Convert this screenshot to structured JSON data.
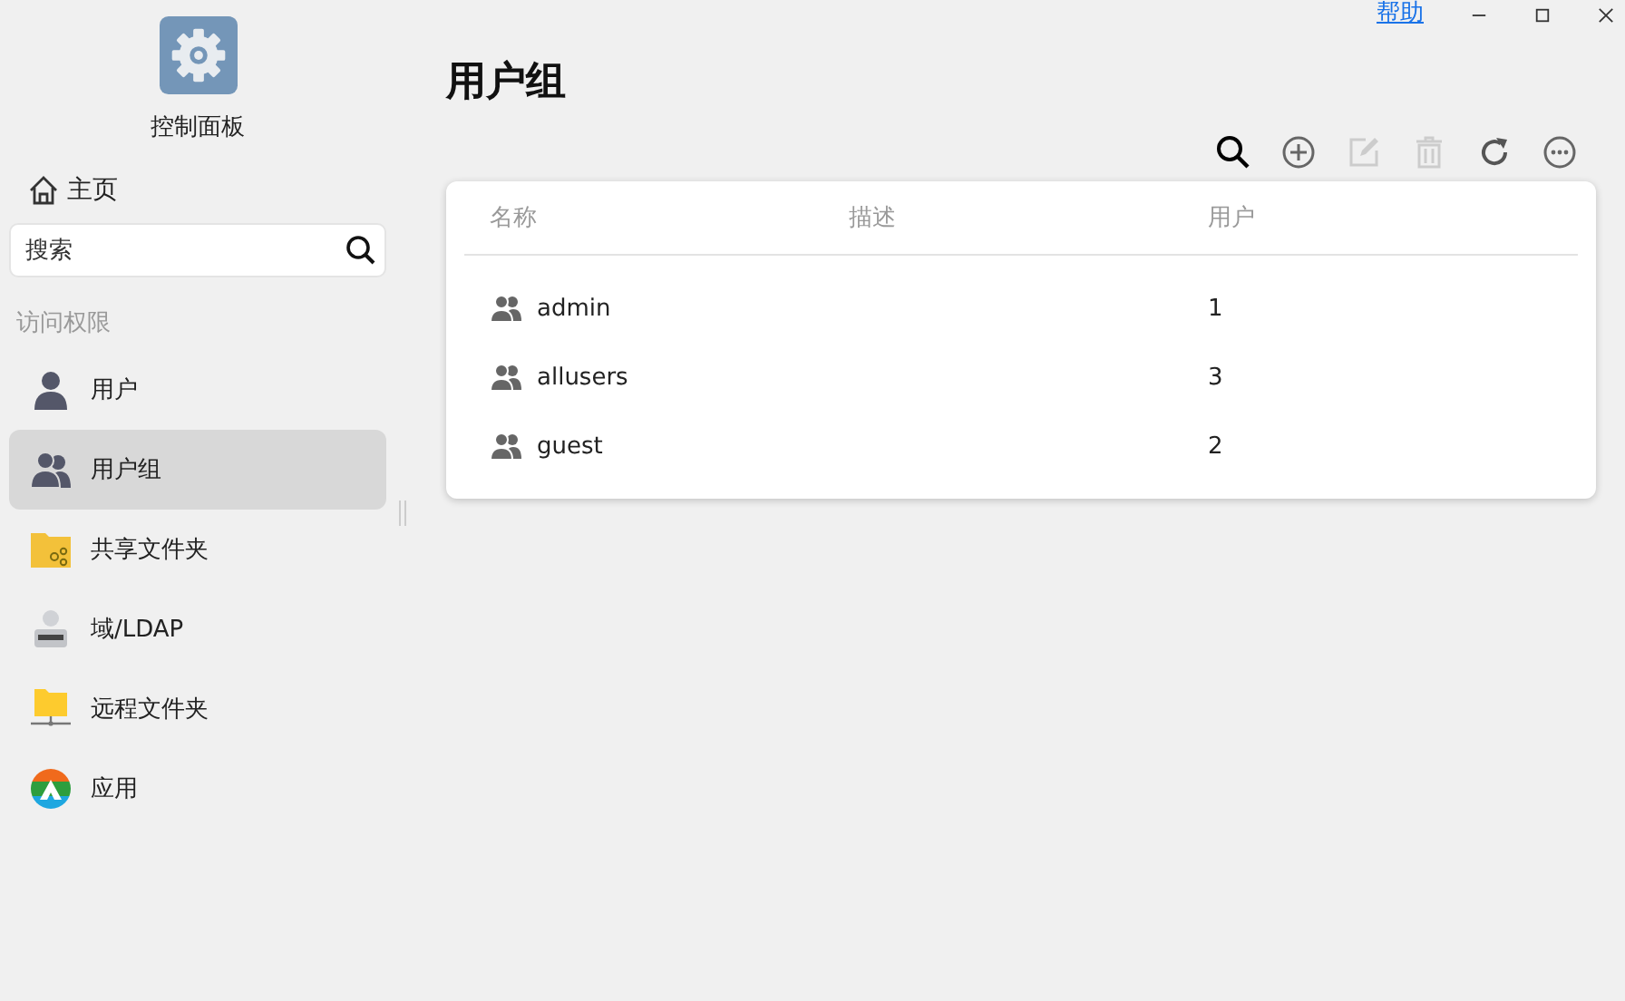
{
  "app": {
    "title": "控制面板"
  },
  "help_link": "帮助",
  "sidebar": {
    "home": "主页",
    "search": {
      "placeholder": "搜索"
    },
    "section": "访问权限",
    "items": [
      {
        "label": "用户",
        "kind": "user",
        "selected": false
      },
      {
        "label": "用户组",
        "kind": "group",
        "selected": true
      },
      {
        "label": "共享文件夹",
        "kind": "shared-folder",
        "selected": false
      },
      {
        "label": "域/LDAP",
        "kind": "ldap",
        "selected": false
      },
      {
        "label": "远程文件夹",
        "kind": "remote-folder",
        "selected": false
      },
      {
        "label": "应用",
        "kind": "app",
        "selected": false
      }
    ]
  },
  "page": {
    "title": "用户组"
  },
  "toolbar": [
    {
      "kind": "search",
      "disabled": false
    },
    {
      "kind": "add",
      "disabled": false
    },
    {
      "kind": "edit",
      "disabled": true
    },
    {
      "kind": "delete",
      "disabled": true
    },
    {
      "kind": "refresh",
      "disabled": false
    },
    {
      "kind": "more",
      "disabled": false
    }
  ],
  "table": {
    "columns": [
      "名称",
      "描述",
      "用户"
    ],
    "rows": [
      {
        "name": "admin",
        "users": "1"
      },
      {
        "name": "allusers",
        "users": "3"
      },
      {
        "name": "guest",
        "users": "2"
      }
    ]
  }
}
